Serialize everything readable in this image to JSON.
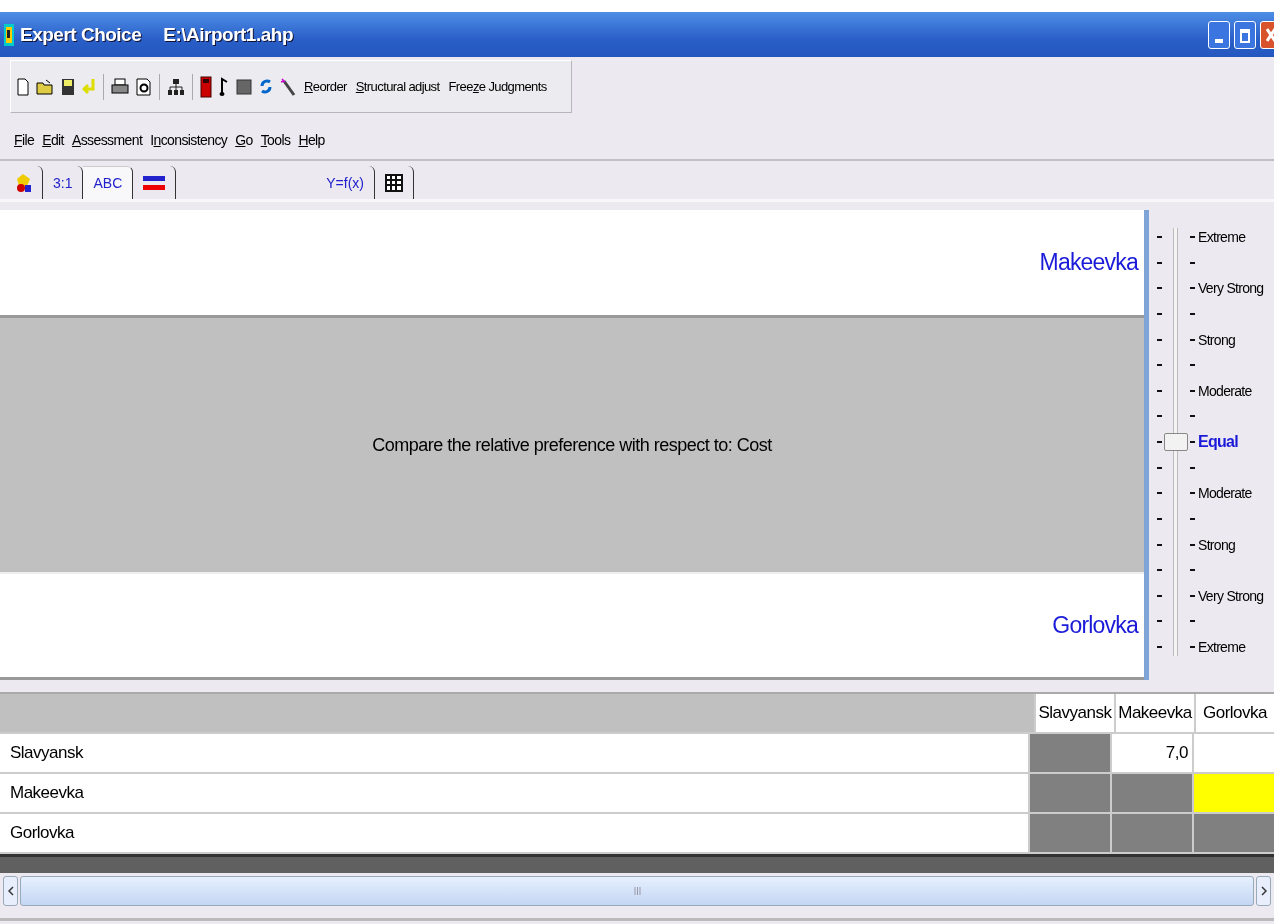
{
  "window": {
    "title": "Expert Choice",
    "file": "E:\\Airport1.ahp"
  },
  "toolbar": {
    "buttons": [
      {
        "key": "R",
        "post": "eorder"
      },
      {
        "key": "S",
        "post": "tructural adjust"
      },
      {
        "pre": "Free",
        "key": "z",
        "post": "e Judgments"
      }
    ]
  },
  "menu": [
    {
      "key": "F",
      "post": "ile"
    },
    {
      "key": "E",
      "post": "dit"
    },
    {
      "key": "A",
      "post": "ssessment"
    },
    {
      "pre": "I",
      "key": "n",
      "post": "consistency"
    },
    {
      "key": "G",
      "post": "o"
    },
    {
      "key": "T",
      "post": "ools"
    },
    {
      "key": "H",
      "post": "elp"
    }
  ],
  "tab_groups": [
    [
      {
        "kind": "shapes",
        "selected": false
      },
      {
        "kind": "text",
        "label": "3:1",
        "selected": false
      },
      {
        "kind": "text",
        "label": "ABC",
        "selected": true
      },
      {
        "kind": "bars",
        "selected": false
      }
    ],
    [
      {
        "kind": "text",
        "label": "Y=f(x)",
        "selected": false
      },
      {
        "kind": "grid",
        "selected": false
      }
    ]
  ],
  "comparison": {
    "top_item": "Makeevka",
    "prompt": "Compare the relative preference  with respect to: Cost",
    "bottom_item": "Gorlovka"
  },
  "scale": {
    "level": 0.5,
    "labels": [
      {
        "label": "Extreme",
        "selected": false
      },
      {
        "label": "Very Strong",
        "selected": false
      },
      {
        "label": "Strong",
        "selected": false
      },
      {
        "label": "Moderate",
        "selected": false
      },
      {
        "label": "Equal",
        "selected": true
      },
      {
        "label": "Moderate",
        "selected": false
      },
      {
        "label": "Strong",
        "selected": false
      },
      {
        "label": "Very Strong",
        "selected": false
      },
      {
        "label": "Extreme",
        "selected": false
      }
    ]
  },
  "matrix": {
    "columns": [
      "Slavyansk",
      "Makeevka",
      "Gorlovka"
    ],
    "rows": [
      {
        "name": "Slavyansk",
        "cells": [
          {
            "kind": "shaded"
          },
          {
            "kind": "value",
            "value": "7,0"
          },
          {
            "kind": "empty"
          }
        ]
      },
      {
        "name": "Makeevka",
        "cells": [
          {
            "kind": "shaded"
          },
          {
            "kind": "shaded"
          },
          {
            "kind": "current"
          }
        ]
      },
      {
        "name": "Gorlovka",
        "cells": [
          {
            "kind": "shaded"
          },
          {
            "kind": "shaded"
          },
          {
            "kind": "shaded"
          }
        ]
      }
    ]
  }
}
